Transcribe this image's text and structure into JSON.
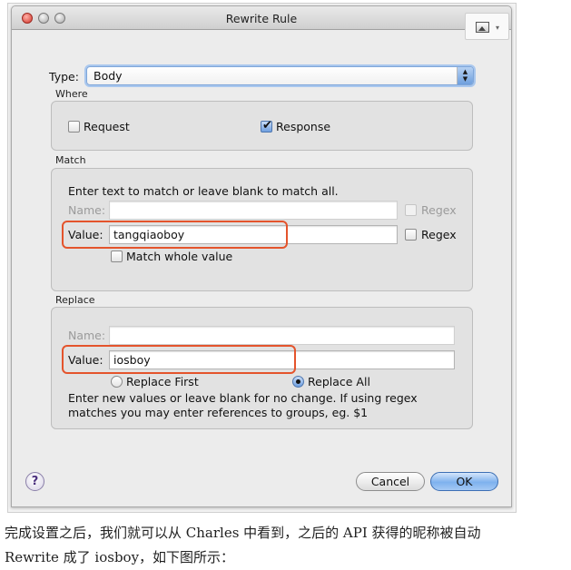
{
  "window": {
    "title": "Rewrite Rule",
    "image_button_icon": "image-icon",
    "image_button_caret": "▾"
  },
  "type": {
    "label": "Type:",
    "value": "Body",
    "arrows": "▲▼"
  },
  "where": {
    "title": "Where",
    "request_label": "Request",
    "request_checked": false,
    "response_label": "Response",
    "response_checked": true
  },
  "match": {
    "title": "Match",
    "hint": "Enter text to match or leave blank to match all.",
    "name_label": "Name:",
    "name_value": "",
    "name_regex_label": "Regex",
    "name_regex_checked": false,
    "value_label": "Value:",
    "value_value": "tangqiaoboy",
    "value_regex_label": "Regex",
    "value_regex_checked": false,
    "whole_value_label": "Match whole value",
    "whole_value_checked": false
  },
  "replace": {
    "title": "Replace",
    "name_label": "Name:",
    "name_value": "",
    "value_label": "Value:",
    "value_value": "iosboy",
    "replace_first_label": "Replace First",
    "replace_all_label": "Replace All",
    "selected": "Replace All",
    "hint_line1": "Enter new values or leave blank for no change. If using regex",
    "hint_line2": "matches you may enter references to groups, eg. $1"
  },
  "footer": {
    "help": "?",
    "cancel": "Cancel",
    "ok": "OK"
  },
  "colors": {
    "highlight": "#e4542c",
    "accent": "#6f9fe0"
  },
  "caption": {
    "line1": "完成设置之后，我们就可以从 Charles 中看到，之后的 API 获得的昵称被自动",
    "line2": "Rewrite 成了 iosboy，如下图所示："
  }
}
